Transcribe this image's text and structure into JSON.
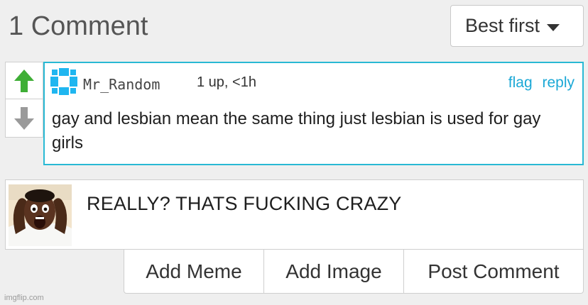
{
  "header": {
    "comment_count_label": "1 Comment",
    "sort_label": "Best first",
    "sort_icon": "chevron-down-icon"
  },
  "vote": {
    "upvote_icon": "arrow-up-icon",
    "downvote_icon": "arrow-down-icon",
    "upvote_color": "#3fae36",
    "downvote_color": "#9a9a9a"
  },
  "comment": {
    "username": "Mr_Random",
    "meta": "1 up, <1h",
    "flag_label": "flag",
    "reply_label": "reply",
    "text": "gay and lesbian mean the same thing just lesbian is used for gay girls",
    "avatar_color": "#1fb6f0",
    "border_color": "#29b9d4"
  },
  "reply": {
    "text": "REALLY? THATS FUCKING CRAZY",
    "image_icon": "shocked-man-meme-image"
  },
  "buttons": {
    "add_meme": "Add Meme",
    "add_image": "Add Image",
    "post_comment": "Post Comment"
  },
  "footer": {
    "watermark": "imgflip.com"
  }
}
